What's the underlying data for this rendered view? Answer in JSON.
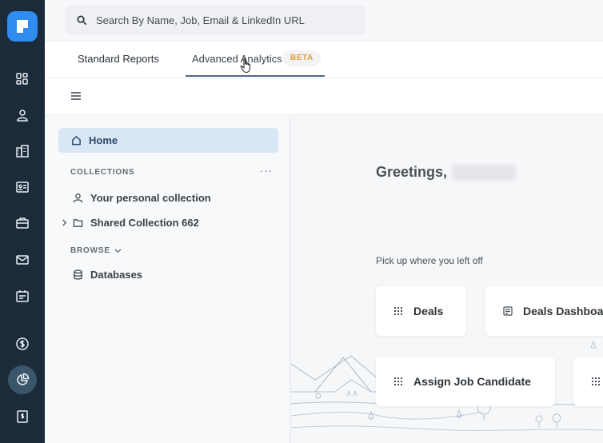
{
  "topbar": {
    "search_placeholder": "Search By Name, Job, Email & LinkedIn URL"
  },
  "tabs": {
    "standard": "Standard Reports",
    "advanced": "Advanced Analytics",
    "beta_badge": "BETA"
  },
  "sidebar": {
    "home": "Home",
    "collections_title": "COLLECTIONS",
    "more": "···",
    "personal_collection": "Your personal collection",
    "shared_collection": "Shared Collection 662",
    "browse_title": "BROWSE",
    "databases": "Databases"
  },
  "main": {
    "greeting": "Greetings,",
    "pickup": "Pick up where you left off",
    "cards": [
      "Deals",
      "Deals Dashboard",
      "Assign Job Candidate"
    ]
  },
  "rail": {
    "icons": [
      "dashboard-icon",
      "contacts-icon",
      "companies-icon",
      "id-card-icon",
      "jobs-icon",
      "mail-icon",
      "calendar-icon",
      "billing-icon",
      "analytics-icon",
      "invoice-icon"
    ],
    "active": "analytics-icon"
  },
  "colors": {
    "rail_bg": "#1c2b3a",
    "logo_blue": "#2f8cf0",
    "beta_orange": "#e39b3c",
    "home_highlight": "#d9e6f5"
  }
}
